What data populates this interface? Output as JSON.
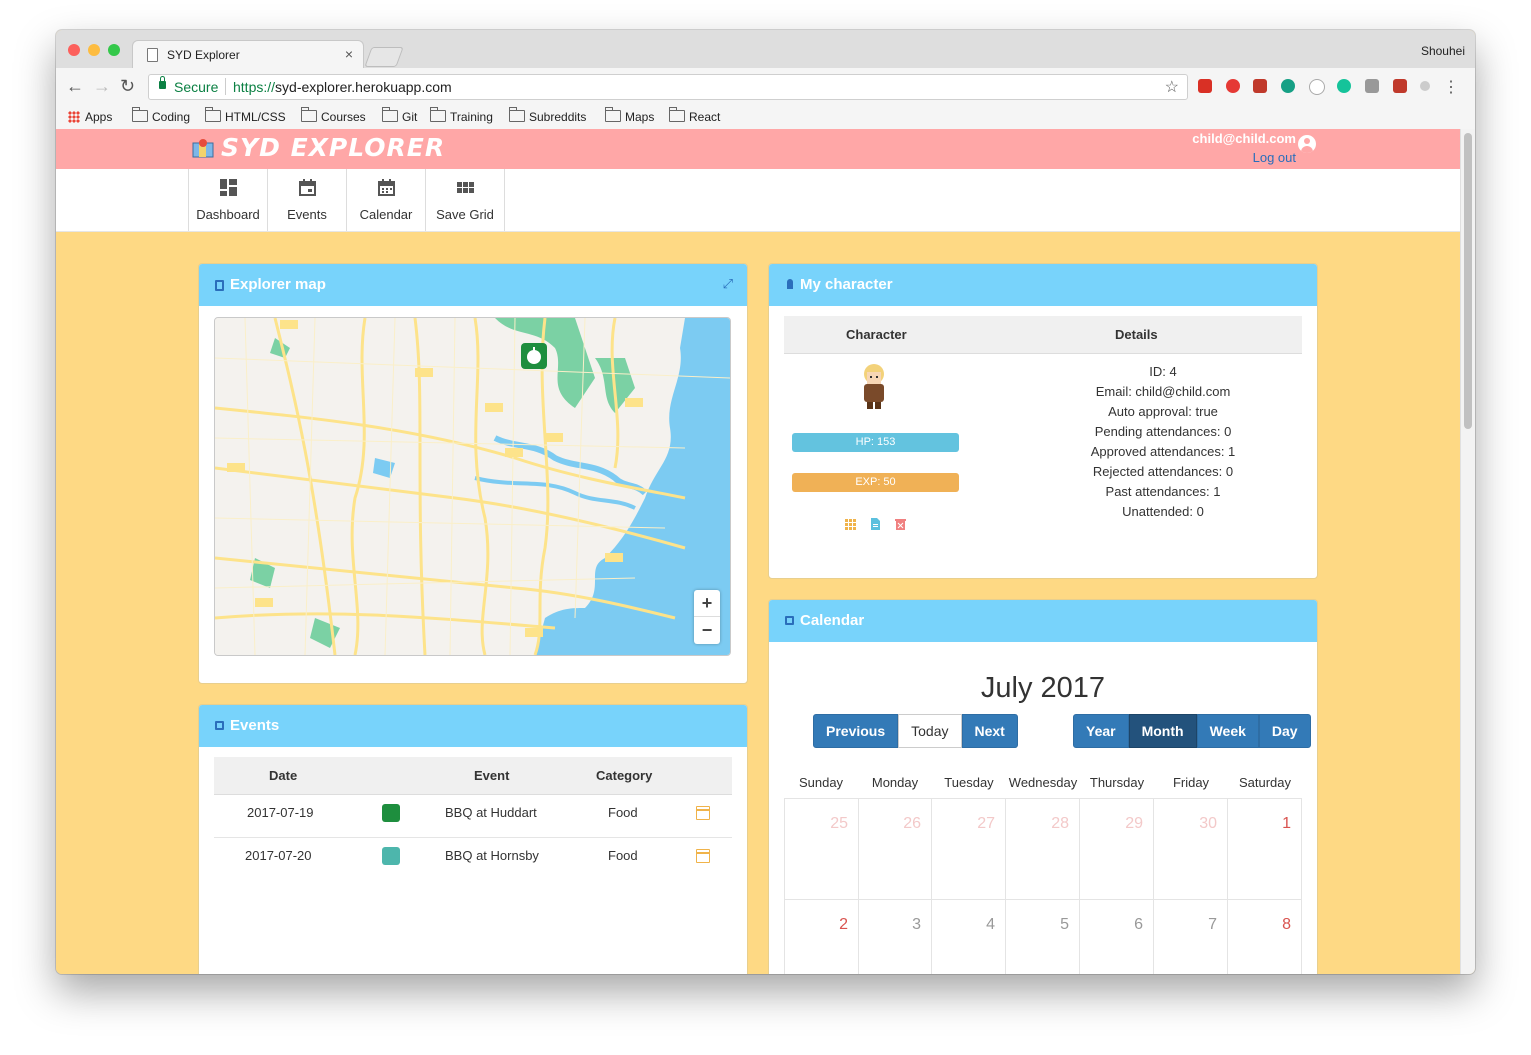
{
  "browser": {
    "tab_title": "SYD Explorer",
    "tab_close": "×",
    "profile_name": "Shouhei",
    "secure_label": "Secure",
    "url_scheme": "https://",
    "url_host": "syd-explorer.herokuapp.com",
    "bookmarks": [
      "Apps",
      "Coding",
      "HTML/CSS",
      "Courses",
      "Git",
      "Training",
      "Subreddits",
      "Maps",
      "React"
    ]
  },
  "header": {
    "brand": "SYD EXPLORER",
    "user_email": "child@child.com",
    "logout": "Log out"
  },
  "nav": {
    "items": [
      {
        "label": "Dashboard",
        "icon": "dashboard-icon"
      },
      {
        "label": "Events",
        "icon": "calendar-icon"
      },
      {
        "label": "Calendar",
        "icon": "calendar-grid-icon"
      },
      {
        "label": "Save Grid",
        "icon": "grid-icon"
      }
    ]
  },
  "map_panel": {
    "title": "Explorer map",
    "zoom_in": "+",
    "zoom_out": "−"
  },
  "events_panel": {
    "title": "Events",
    "columns": [
      "Date",
      "Event",
      "Category"
    ],
    "rows": [
      {
        "date": "2017-07-19",
        "event": "BBQ at Huddart",
        "category": "Food",
        "pin_color": "#1e8e3e"
      },
      {
        "date": "2017-07-20",
        "event": "BBQ at Hornsby",
        "category": "Food",
        "pin_color": "#4db6ac"
      }
    ]
  },
  "character_panel": {
    "title": "My character",
    "columns": [
      "Character",
      "Details"
    ],
    "hp": {
      "label": "HP: 153",
      "percent": 100,
      "color": "#5bc0de"
    },
    "exp": {
      "label": "EXP: 50",
      "percent": 100,
      "color": "#f0ad4e"
    },
    "details": [
      "ID: 4",
      "Email: child@child.com",
      "Auto approval: true",
      "Pending attendances: 0",
      "Approved attendances: 1",
      "Rejected attendances: 0",
      "Past attendances: 1",
      "Unattended: 0"
    ]
  },
  "calendar_panel": {
    "title": "Calendar",
    "month_title": "July 2017",
    "nav_buttons": [
      "Previous",
      "Today",
      "Next"
    ],
    "view_buttons": [
      "Year",
      "Month",
      "Week",
      "Day"
    ],
    "active_view": "Month",
    "weekdays": [
      "Sunday",
      "Monday",
      "Tuesday",
      "Wednesday",
      "Thursday",
      "Friday",
      "Saturday"
    ],
    "weeks": [
      [
        {
          "day": "25",
          "muted": true
        },
        {
          "day": "26",
          "muted": true
        },
        {
          "day": "27",
          "muted": true
        },
        {
          "day": "28",
          "muted": true
        },
        {
          "day": "29",
          "muted": true
        },
        {
          "day": "30",
          "muted": true
        },
        {
          "day": "1",
          "weekend": true
        }
      ],
      [
        {
          "day": "2",
          "weekend": true
        },
        {
          "day": "3"
        },
        {
          "day": "4"
        },
        {
          "day": "5"
        },
        {
          "day": "6"
        },
        {
          "day": "7"
        },
        {
          "day": "8",
          "weekend": true
        }
      ]
    ]
  }
}
